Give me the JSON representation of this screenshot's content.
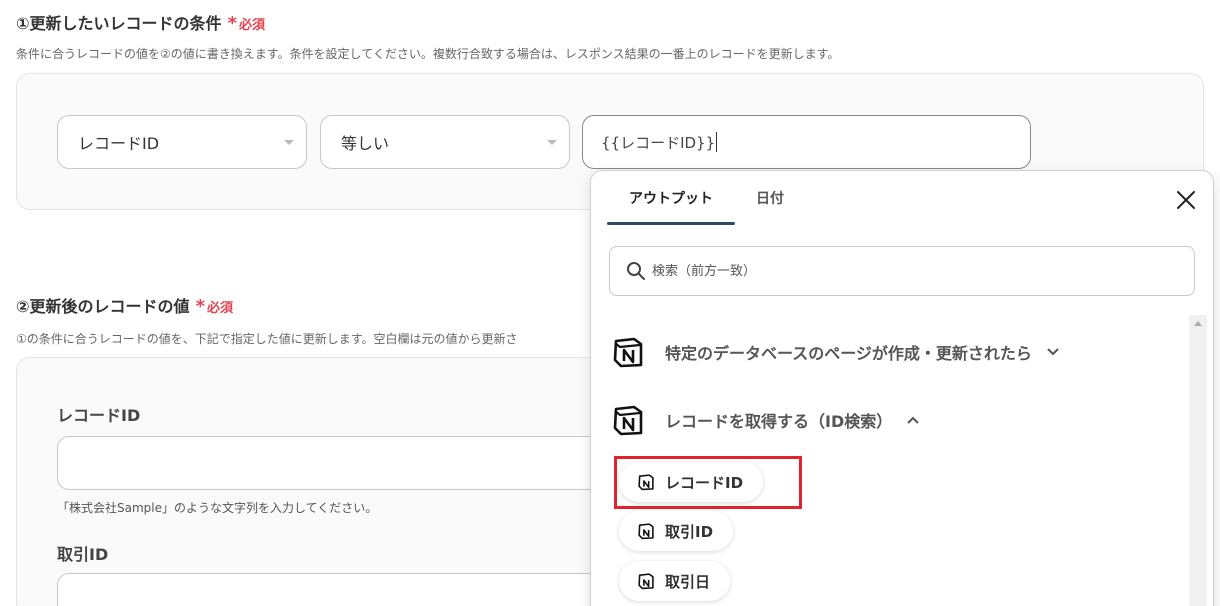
{
  "section1": {
    "title": "①更新したいレコードの条件",
    "required": "必須",
    "description": "条件に合うレコードの値を②の値に書き換えます。条件を設定してください。複数行合致する場合は、レスポンス結果の一番上のレコードを更新します。",
    "field_select": "レコードID",
    "operator_select": "等しい",
    "value_input": "{{レコードID}}"
  },
  "section2": {
    "title": "②更新後のレコードの値",
    "required": "必須",
    "description": "①の条件に合うレコードの値を、下記で指定した値に更新します。空白欄は元の値から更新さ",
    "fields": [
      {
        "label": "レコードID",
        "hint": "「株式会社Sample」のような文字列を入力してください。"
      },
      {
        "label": "取引ID"
      }
    ]
  },
  "popup": {
    "tabs": [
      "アウトプット",
      "日付"
    ],
    "search_placeholder": "検索（前方一致）",
    "groups": [
      {
        "label": "特定のデータベースのページが作成・更新されたら",
        "expanded": false
      },
      {
        "label": "レコードを取得する（ID検索）",
        "expanded": true
      }
    ],
    "items": [
      "レコードID",
      "取引ID",
      "取引日"
    ]
  },
  "colors": {
    "required": "#e0454f",
    "highlight": "#e0232c",
    "tab_underline": "#2e4a66"
  }
}
